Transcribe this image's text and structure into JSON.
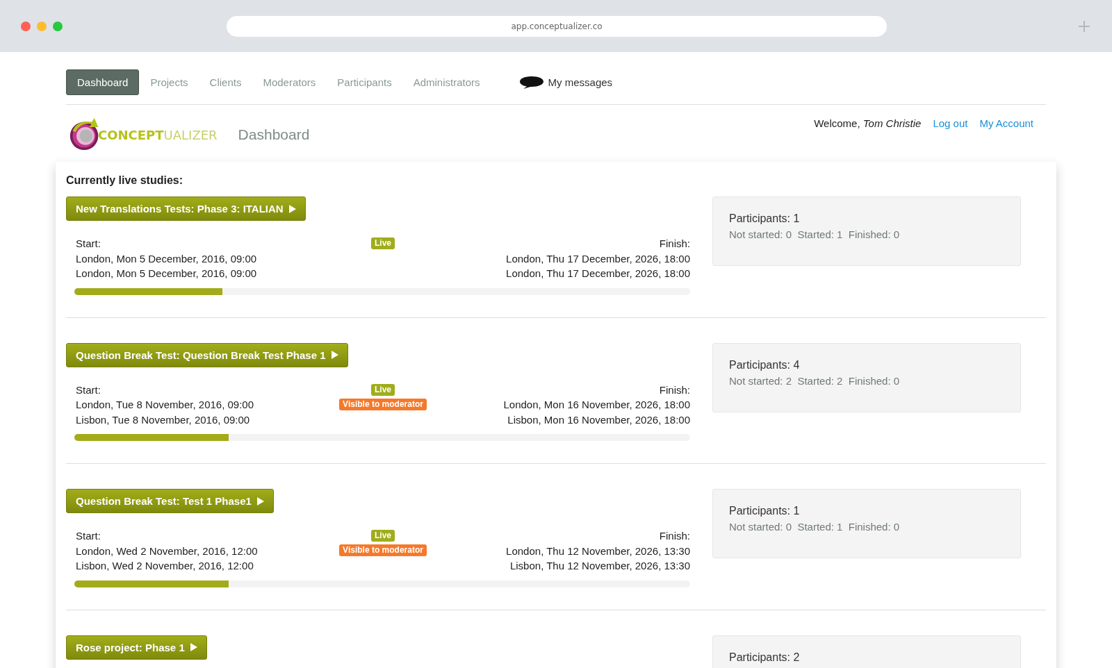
{
  "browser": {
    "url": "app.conceptualizer.co"
  },
  "nav": [
    {
      "label": "Dashboard",
      "selected": true
    },
    {
      "label": "Projects",
      "selected": false
    },
    {
      "label": "Clients",
      "selected": false
    },
    {
      "label": "Moderators",
      "selected": false
    },
    {
      "label": "Participants",
      "selected": false
    },
    {
      "label": "Administrators",
      "selected": false
    }
  ],
  "messages": {
    "label": "My messages"
  },
  "logo": {
    "strong": "CONCEPT",
    "light": "UALIZER"
  },
  "page_title": "Dashboard",
  "user": {
    "welcome": "Welcome,",
    "name": "Tom Christie",
    "links": [
      "Log out",
      "My Account"
    ]
  },
  "section_title": "Currently live studies:",
  "studies": [
    {
      "title": "New Translations Tests: Phase 3: ITALIAN",
      "start_label": "Start:",
      "finish_label": "Finish:",
      "starts": [
        "London, Mon 5 December, 2016, 09:00",
        "London, Mon 5 December, 2016, 09:00"
      ],
      "finishes": [
        "London, Thu 17 December, 2026, 18:00",
        "London, Thu 17 December, 2026, 18:00"
      ],
      "badges": [
        {
          "label": "Live",
          "kind": "live"
        }
      ],
      "level": 0.24,
      "participants": "Participants: 1",
      "counts": "Not started: 0  Started: 1  Finished: 0"
    },
    {
      "title": "Question Break Test: Question Break Test Phase 1",
      "start_label": "Start:",
      "finish_label": "Finish:",
      "starts": [
        "London, Tue 8 November, 2016, 09:00",
        "Lisbon, Tue 8 November, 2016, 09:00"
      ],
      "finishes": [
        "London, Mon 16 November, 2026, 18:00",
        "Lisbon, Mon 16 November, 2026, 18:00"
      ],
      "badges": [
        {
          "label": "Live",
          "kind": "live"
        },
        {
          "label": "Visible to moderator",
          "kind": "visible"
        }
      ],
      "level": 0.25,
      "participants": "Participants: 4",
      "counts": "Not started: 2  Started: 2  Finished: 0"
    },
    {
      "title": "Question Break Test: Test 1 Phase1",
      "start_label": "Start:",
      "finish_label": "Finish:",
      "starts": [
        "London, Wed 2 November, 2016, 12:00",
        "Lisbon, Wed 2 November, 2016, 12:00"
      ],
      "finishes": [
        "London, Thu 12 November, 2026, 13:30",
        "Lisbon, Thu 12 November, 2026, 13:30"
      ],
      "badges": [
        {
          "label": "Live",
          "kind": "live"
        },
        {
          "label": "Visible to moderator",
          "kind": "visible"
        }
      ],
      "level": 0.25,
      "participants": "Participants: 1",
      "counts": "Not started: 0  Started: 1  Finished: 0"
    },
    {
      "title": "Rose project: Phase 1",
      "participants": "Participants: 2"
    }
  ]
}
